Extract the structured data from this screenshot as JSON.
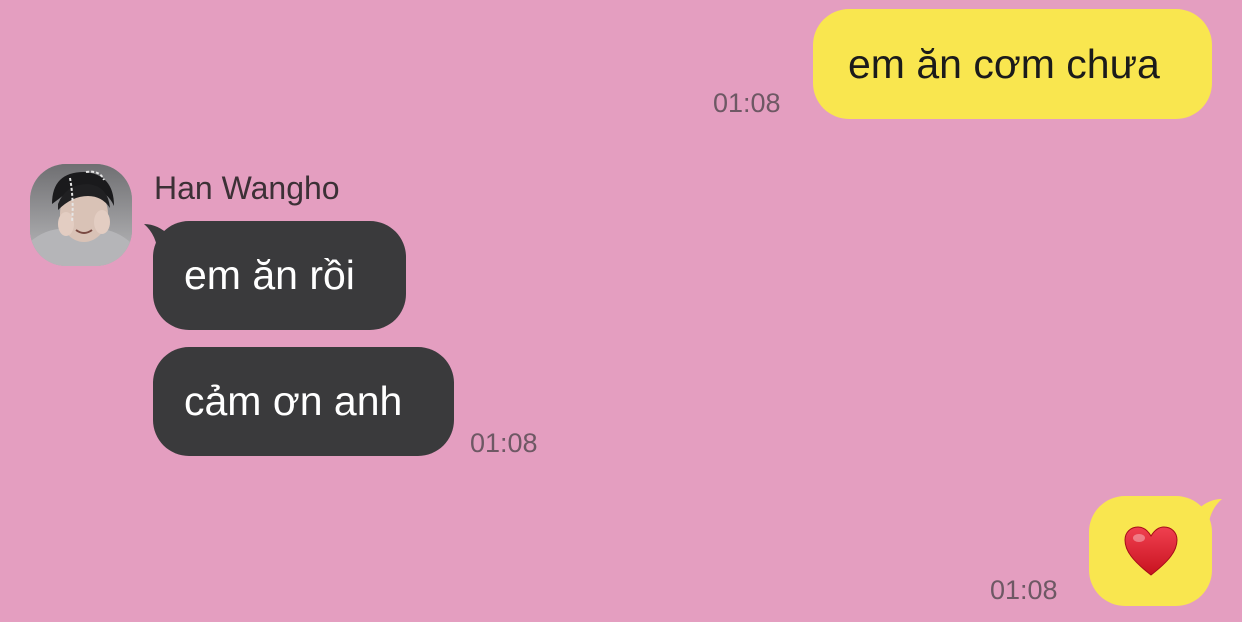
{
  "messages": [
    {
      "direction": "outgoing",
      "text": "em ăn cơm chưa",
      "time": "01:08"
    },
    {
      "direction": "incoming",
      "sender": "Han Wangho",
      "text": "em ăn rồi"
    },
    {
      "direction": "incoming",
      "text": "cảm ơn anh",
      "time": "01:08"
    },
    {
      "direction": "outgoing",
      "emoji": "red-heart",
      "time": "01:08"
    }
  ],
  "colors": {
    "background": "#e49ec0",
    "outgoing_bubble": "#f9e64f",
    "incoming_bubble": "#3a3a3c",
    "timestamp": "#6e5864",
    "heart": "#d8192c"
  }
}
